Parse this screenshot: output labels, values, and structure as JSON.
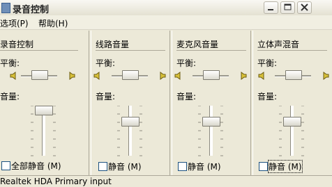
{
  "window": {
    "title": "录音控制"
  },
  "menu": {
    "items": [
      "选项(P)",
      "帮助(H)"
    ]
  },
  "panels": [
    {
      "title": "录音控制",
      "balance_label": "平衡:",
      "volume_label": "音量:",
      "balance": 0.5,
      "volume": 1.0,
      "mute_label": "全部静音 (M)",
      "mute_checked": false
    },
    {
      "title": "线路音量",
      "balance_label": "平衡:",
      "volume_label": "音量:",
      "balance": 0.5,
      "volume": 0.7,
      "mute_label": "静音 (M)",
      "mute_checked": false
    },
    {
      "title": "麦克风音量",
      "balance_label": "平衡:",
      "volume_label": "音量:",
      "balance": 0.5,
      "volume": 0.7,
      "mute_label": "静音 (M)",
      "mute_checked": false
    },
    {
      "title": "立体声混音",
      "balance_label": "平衡:",
      "volume_label": "音量:",
      "balance": 0.5,
      "volume": 0.7,
      "mute_label": "静音 (M)",
      "mute_checked": false
    }
  ],
  "status": {
    "text": "Realtek HDA Primary input"
  }
}
